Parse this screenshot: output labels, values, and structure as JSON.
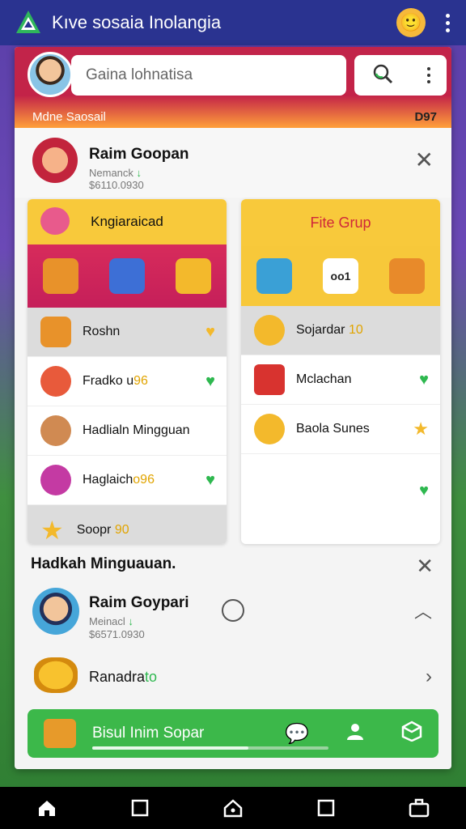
{
  "appbar": {
    "title": "Kıve sosaia Inolangia",
    "avatar_emoji": "🙂"
  },
  "header": {
    "search_text": "Gaina lohnatisa",
    "strip_label": "Mdne Saosail",
    "strip_count": "D97"
  },
  "user": {
    "name": "Raim Goopan",
    "sub1": "Nemanck",
    "sub2": "$6110.0930"
  },
  "panel_left": {
    "title": "Kngiaraicad",
    "rows": [
      {
        "label": "Roshn",
        "accent": "",
        "badge": "heart-gold"
      },
      {
        "label": "Fradko u",
        "accent": "96",
        "badge": "heart"
      },
      {
        "label": "Hadlialn Mingguan",
        "accent": "",
        "badge": ""
      },
      {
        "label": "Haglaich",
        "accent": "o96",
        "badge": "heart"
      },
      {
        "label": "Soopr",
        "accent": "90",
        "badge": ""
      }
    ]
  },
  "panel_right": {
    "title": "Fite Grup",
    "tile_text": "oo1",
    "rows": [
      {
        "label": "Sojardar",
        "accent": "10",
        "badge": ""
      },
      {
        "label": "Mclachan",
        "accent": "",
        "badge": "heart"
      },
      {
        "label": "Baola Sunes",
        "accent": "",
        "badge": "star"
      },
      {
        "label": "",
        "accent": "",
        "badge": "heart"
      }
    ]
  },
  "section": {
    "title": "Hadkah Minguauan."
  },
  "user2": {
    "name": "Raim Goypari",
    "sub1": "Meinacl",
    "sub2": "$6571.0930"
  },
  "coin_row": {
    "label_main": "Ranadra",
    "label_green": "to"
  },
  "cta": {
    "label": "Bisul Inim Sopar",
    "progress": 0.66
  },
  "colors": {
    "appbar": "#2a3390",
    "accent_green": "#3cb84a",
    "header_red": "#c2244a",
    "panel_yellow": "#f8c93b"
  }
}
